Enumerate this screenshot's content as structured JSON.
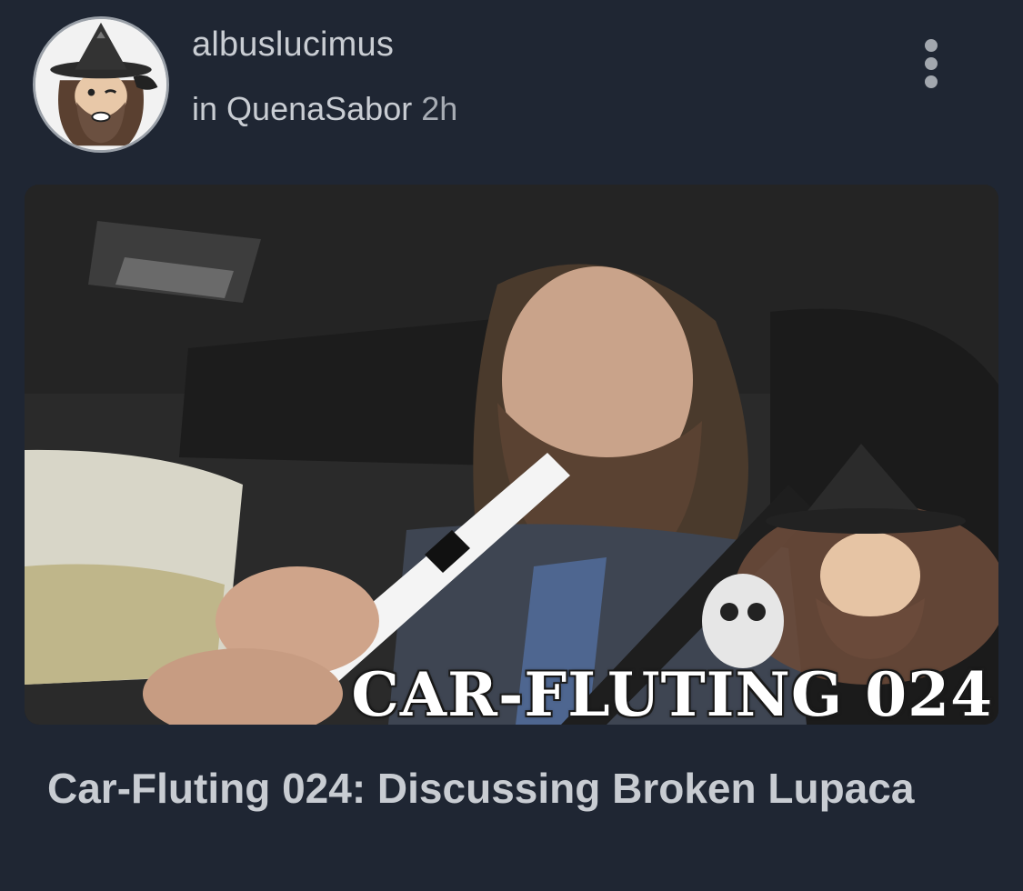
{
  "post": {
    "author": "albuslucimus",
    "community_prefix": "in",
    "community": "QuenaSabor",
    "age": "2h",
    "thumbnail_caption": "CAR-FLUTING 024",
    "title": "Car-Fluting 024: Discussing Broken Lupaca"
  },
  "icons": {
    "more": "vertical-ellipsis-icon",
    "avatar": "wizard-avatar"
  },
  "colors": {
    "background": "#1f2633",
    "text": "#c9cdd3",
    "muted": "#a7acb4"
  }
}
